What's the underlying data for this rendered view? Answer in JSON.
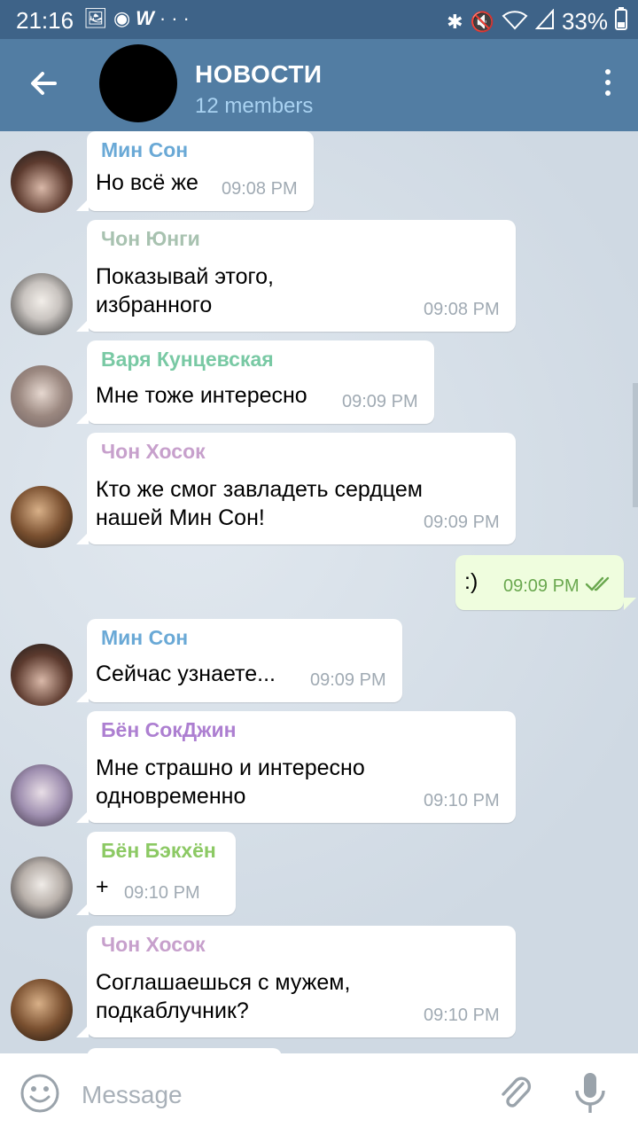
{
  "status_bar": {
    "time": "21:16",
    "battery": "33%",
    "left_icons": [
      "image-icon",
      "bolt-icon",
      "w-icon",
      "more-icon"
    ],
    "right_icons": [
      "bluetooth-icon",
      "mute-icon",
      "wifi-icon",
      "signal-icon"
    ]
  },
  "header": {
    "title": "НОВОСТИ",
    "subtitle": "12 members",
    "bg": "#527da3",
    "status_bg": "#3e6388"
  },
  "messages": [
    {
      "sender": "Мин  Сон",
      "sender_color": "#6aa9d6",
      "text": "Но всё же",
      "time": "09:08 PM",
      "avatar": "avatar-min-son"
    },
    {
      "sender": "Чон Юнги",
      "sender_color": "#a8c2b0",
      "text": "Показывай этого,\nизбранного",
      "time": "09:08 PM",
      "avatar": "avatar-yoongi"
    },
    {
      "sender": "Варя Кунцевская",
      "sender_color": "#79c9a4",
      "text": "Мне тоже интересно",
      "time": "09:09 PM",
      "avatar": "avatar-varya"
    },
    {
      "sender": "Чон  Хосок",
      "sender_color": "#c7a0cc",
      "text": "Кто же смог завладеть сердцем\nнашей Мин Сон!",
      "time": "09:09 PM",
      "avatar": "avatar-hoseok"
    },
    {
      "sender": "",
      "sender_color": "",
      "text": ":)",
      "time": "09:09 PM",
      "outgoing": true
    },
    {
      "sender": "Мин  Сон",
      "sender_color": "#6aa9d6",
      "text": "Сейчас узнаете...",
      "time": "09:09 PM",
      "avatar": "avatar-min-son"
    },
    {
      "sender": "Бён СокДжин",
      "sender_color": "#ad7fd1",
      "text": "Мне страшно и интересно\nодновременно",
      "time": "09:10 PM",
      "avatar": "avatar-seokjin"
    },
    {
      "sender": "Бён Бэкхён",
      "sender_color": "#8cc964",
      "text": "+",
      "time": "09:10 PM",
      "avatar": "avatar-baekhyun"
    },
    {
      "sender": "Чон  Хосок",
      "sender_color": "#c7a0cc",
      "text": "Соглашаешься с мужем,\nподкаблучник?",
      "time": "09:10 PM",
      "avatar": "avatar-hoseok"
    }
  ],
  "input": {
    "placeholder": "Message"
  }
}
